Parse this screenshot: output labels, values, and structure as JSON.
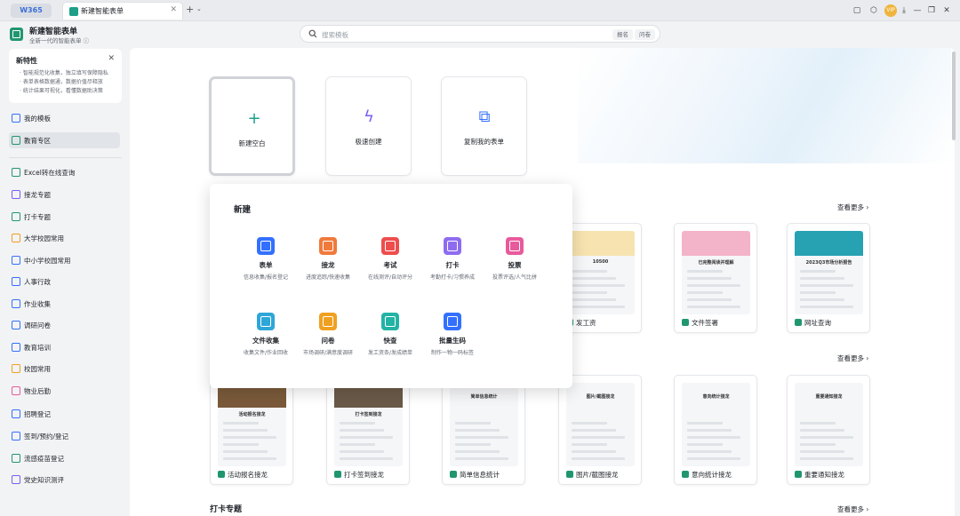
{
  "app": {
    "logo": "W365",
    "tab_title": "新建智能表单",
    "tab_close": "✕",
    "tab_add": "+",
    "tab_dropdown": "⌄"
  },
  "window": {
    "buttons": [
      "▢",
      "⬡",
      "⤓",
      "—",
      "❐",
      "✕"
    ],
    "avatar": "VIP"
  },
  "header": {
    "title": "新建智能表单",
    "subtitle": "全新一代的智能表单 ⓘ"
  },
  "search": {
    "placeholder": "搜索模板",
    "tags": [
      "报名",
      "问卷"
    ]
  },
  "new_features": {
    "title": "新特性",
    "close": "✕",
    "lines": [
      "· 智能规范化收集，独立填写保障隐私",
      "· 表单表格数据通，数据价值尽释放",
      "· 统计结果可视化，看懂数据助决策"
    ]
  },
  "sidebar": {
    "items": [
      {
        "label": "我的模板",
        "color": "#3370ff"
      },
      {
        "label": "教育专区",
        "color": "#20966f"
      },
      {
        "label": "Excel转在线查询",
        "color": "#20966f"
      },
      {
        "label": "接龙专题",
        "color": "#7b5cf5"
      },
      {
        "label": "打卡专题",
        "color": "#20966f"
      },
      {
        "label": "大学校园常用",
        "color": "#f0a020"
      },
      {
        "label": "中小学校园常用",
        "color": "#3370ff"
      },
      {
        "label": "人事行政",
        "color": "#3370ff"
      },
      {
        "label": "作业收集",
        "color": "#3370ff"
      },
      {
        "label": "调研问卷",
        "color": "#3370ff"
      },
      {
        "label": "教育培训",
        "color": "#3370ff"
      },
      {
        "label": "校园常用",
        "color": "#f0a020"
      },
      {
        "label": "物业后勤",
        "color": "#e85a9b"
      },
      {
        "label": "招聘登记",
        "color": "#3370ff"
      },
      {
        "label": "签到/预约/登记",
        "color": "#3370ff"
      },
      {
        "label": "流感疫苗登记",
        "color": "#20966f"
      },
      {
        "label": "党史知识测评",
        "color": "#7b5cf5"
      }
    ]
  },
  "create": {
    "cards": [
      {
        "label": "新建空白",
        "icon": "plus-icon",
        "color": "#1f9e89",
        "glyph": "+"
      },
      {
        "label": "极速创建",
        "icon": "lightning-icon",
        "color": "#7b5cf5",
        "glyph": "ϟ"
      },
      {
        "label": "复制我的表单",
        "icon": "copy-icon",
        "color": "#3370ff",
        "glyph": "⧉"
      }
    ]
  },
  "popup": {
    "title": "新建",
    "items": [
      {
        "label": "表单",
        "desc": "信息收集/报名登记",
        "icon": "form-icon",
        "color": "#3370ff"
      },
      {
        "label": "接龙",
        "desc": "进度追踪/快速收集",
        "icon": "relay-icon",
        "color": "#f07a3c"
      },
      {
        "label": "考试",
        "desc": "在线测评/自动评分",
        "icon": "exam-icon",
        "color": "#ee4d4d"
      },
      {
        "label": "打卡",
        "desc": "考勤打卡/习惯养成",
        "icon": "checkin-icon",
        "color": "#8e6cf0"
      },
      {
        "label": "投票",
        "desc": "投票评选/人气比拼",
        "icon": "vote-icon",
        "color": "#e85a9b"
      },
      {
        "label": "文件收集",
        "desc": "收集文件/作业回收",
        "icon": "file-collect-icon",
        "color": "#2ea6d8"
      },
      {
        "label": "问卷",
        "desc": "市场调研/满意度调研",
        "icon": "survey-icon",
        "color": "#f0a020"
      },
      {
        "label": "快查",
        "desc": "发工资条/发成绩单",
        "icon": "quick-query-icon",
        "color": "#23b3a5"
      },
      {
        "label": "批量生码",
        "desc": "制作一物一码标签",
        "icon": "qrcode-icon",
        "color": "#3370ff"
      }
    ]
  },
  "templates": {
    "see_more": "查看更多 ›",
    "row1": [
      {
        "label": "发工资",
        "preview_title": "10500"
      },
      {
        "label": "文件签署",
        "preview_title": "已完整阅读并理解"
      },
      {
        "label": "网址查询",
        "preview_title": "2023Q3市场分析报告"
      }
    ],
    "row2": [
      {
        "label": "活动报名接龙",
        "preview_title": "活动报名接龙"
      },
      {
        "label": "打卡签到接龙",
        "preview_title": "打卡签到接龙"
      },
      {
        "label": "简单信息统计",
        "preview_title": "简单信息统计"
      },
      {
        "label": "图片/截图接龙",
        "preview_title": "图片/截图接龙"
      },
      {
        "label": "意向统计接龙",
        "preview_title": "意向统计接龙"
      },
      {
        "label": "重要通知接龙",
        "preview_title": "重要通知接龙"
      }
    ],
    "section_title": "打卡专题"
  }
}
